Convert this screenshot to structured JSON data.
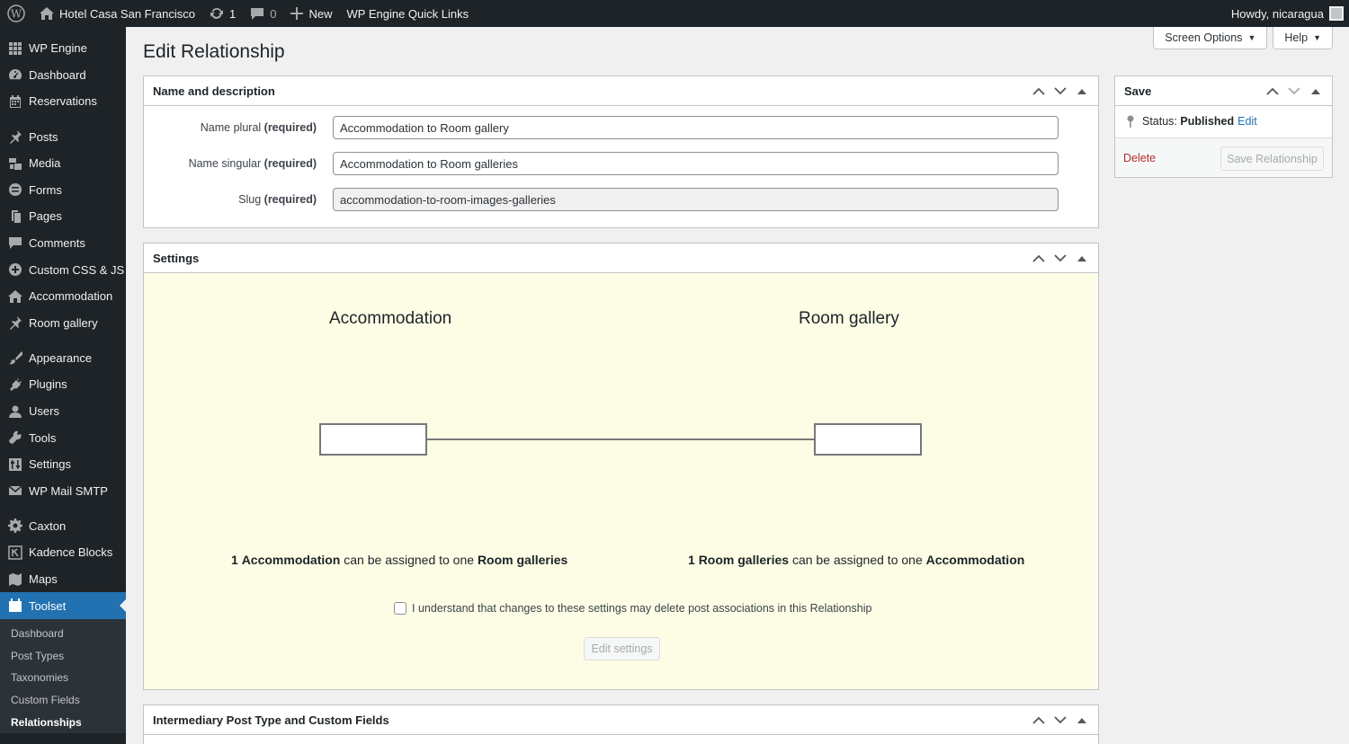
{
  "admin_bar": {
    "site_name": "Hotel Casa San Francisco",
    "updates_count": "1",
    "comments_count": "0",
    "new_label": "New",
    "quick_links": "WP Engine Quick Links",
    "howdy": "Howdy, nicaragua"
  },
  "sidebar": {
    "items": [
      {
        "label": "WP Engine",
        "icon": "grid-icon"
      },
      {
        "label": "Dashboard",
        "icon": "dashboard-icon"
      },
      {
        "label": "Reservations",
        "icon": "calendar-icon"
      },
      {
        "label": "Posts",
        "icon": "pin-icon"
      },
      {
        "label": "Media",
        "icon": "media-icon"
      },
      {
        "label": "Forms",
        "icon": "forms-icon"
      },
      {
        "label": "Pages",
        "icon": "pages-icon"
      },
      {
        "label": "Comments",
        "icon": "comment-icon"
      },
      {
        "label": "Custom CSS & JS",
        "icon": "plus-circle-icon"
      },
      {
        "label": "Accommodation",
        "icon": "home-icon"
      },
      {
        "label": "Room gallery",
        "icon": "pin-icon"
      },
      {
        "label": "Appearance",
        "icon": "brush-icon"
      },
      {
        "label": "Plugins",
        "icon": "plug-icon"
      },
      {
        "label": "Users",
        "icon": "user-icon"
      },
      {
        "label": "Tools",
        "icon": "wrench-icon"
      },
      {
        "label": "Settings",
        "icon": "settings-icon"
      },
      {
        "label": "WP Mail SMTP",
        "icon": "mail-icon"
      },
      {
        "label": "Caxton",
        "icon": "gear-icon"
      },
      {
        "label": "Kadence Blocks",
        "icon": "kadence-icon"
      },
      {
        "label": "Maps",
        "icon": "map-icon"
      },
      {
        "label": "Toolset",
        "icon": "toolset-icon"
      }
    ],
    "submenu": [
      "Dashboard",
      "Post Types",
      "Taxonomies",
      "Custom Fields",
      "Relationships"
    ]
  },
  "screen_options": "Screen Options",
  "help": "Help",
  "page_title": "Edit Relationship",
  "name_box": {
    "title": "Name and description",
    "plural_label": "Name plural",
    "singular_label": "Name singular",
    "slug_label": "Slug",
    "required": "(required)",
    "plural_value": "Accommodation to Room gallery",
    "singular_value": "Accommodation to Room galleries",
    "slug_value": "accommodation-to-room-images-galleries"
  },
  "settings_box": {
    "title": "Settings",
    "left_title": "Accommodation",
    "right_title": "Room gallery",
    "left_desc": {
      "count": "1",
      "subject": "Accommodation",
      "mid": "can be assigned to one",
      "object": "Room galleries"
    },
    "right_desc": {
      "count": "1",
      "subject": "Room galleries",
      "mid": "can be assigned to one",
      "object": "Accommodation"
    },
    "confirm_text": "I understand that changes to these settings may delete post associations in this Relationship",
    "edit_button": "Edit settings"
  },
  "intermediary_box": {
    "title": "Intermediary Post Type and Custom Fields"
  },
  "save_box": {
    "title": "Save",
    "status_label": "Status:",
    "status_value": "Published",
    "edit_link": "Edit",
    "delete": "Delete",
    "save_button": "Save Relationship"
  },
  "colors": {
    "accent": "#2271b1",
    "sidebar_bg": "#1d2327",
    "settings_bg": "#fdfde6",
    "delete": "#b32d2e"
  }
}
